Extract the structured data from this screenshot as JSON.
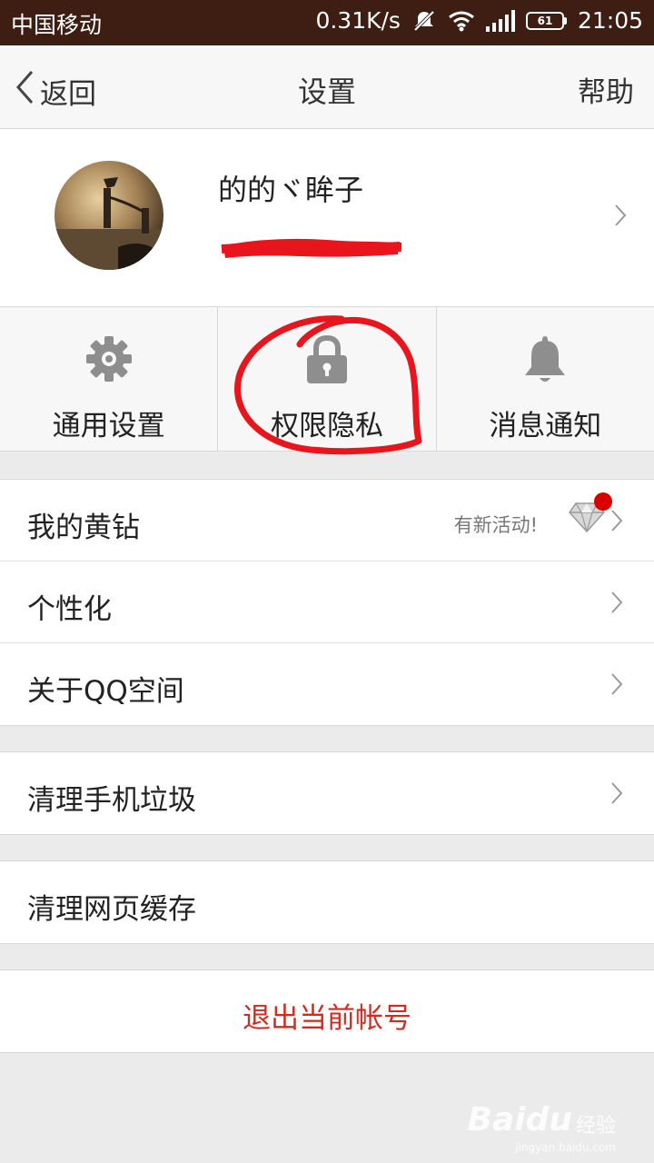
{
  "status_bar": {
    "carrier": "中国移动",
    "speed": "0.31K/s",
    "battery": "61",
    "time": "21:05"
  },
  "nav": {
    "back_label": "返回",
    "title": "设置",
    "help_label": "帮助"
  },
  "profile": {
    "nickname": "的的ヾ眸子"
  },
  "quick_actions": [
    {
      "label": "通用设置",
      "icon": "gear-icon"
    },
    {
      "label": "权限隐私",
      "icon": "lock-icon"
    },
    {
      "label": "消息通知",
      "icon": "bell-icon"
    }
  ],
  "menu": {
    "yellow_diamond": {
      "label": "我的黄钻",
      "promo": "有新活动!"
    },
    "personalize": {
      "label": "个性化"
    },
    "about": {
      "label": "关于QQ空间"
    },
    "clean_junk": {
      "label": "清理手机垃圾"
    },
    "clean_cache": {
      "label": "清理网页缓存"
    },
    "logout": {
      "label": "退出当前帐号"
    }
  },
  "watermark": {
    "brand": "Baidu",
    "sub": "经验",
    "url": "jingyan.baidu.com"
  },
  "colors": {
    "status_bar": "#3e1e12",
    "accent_red": "#d52b1e",
    "annotation": "#e8151d"
  }
}
